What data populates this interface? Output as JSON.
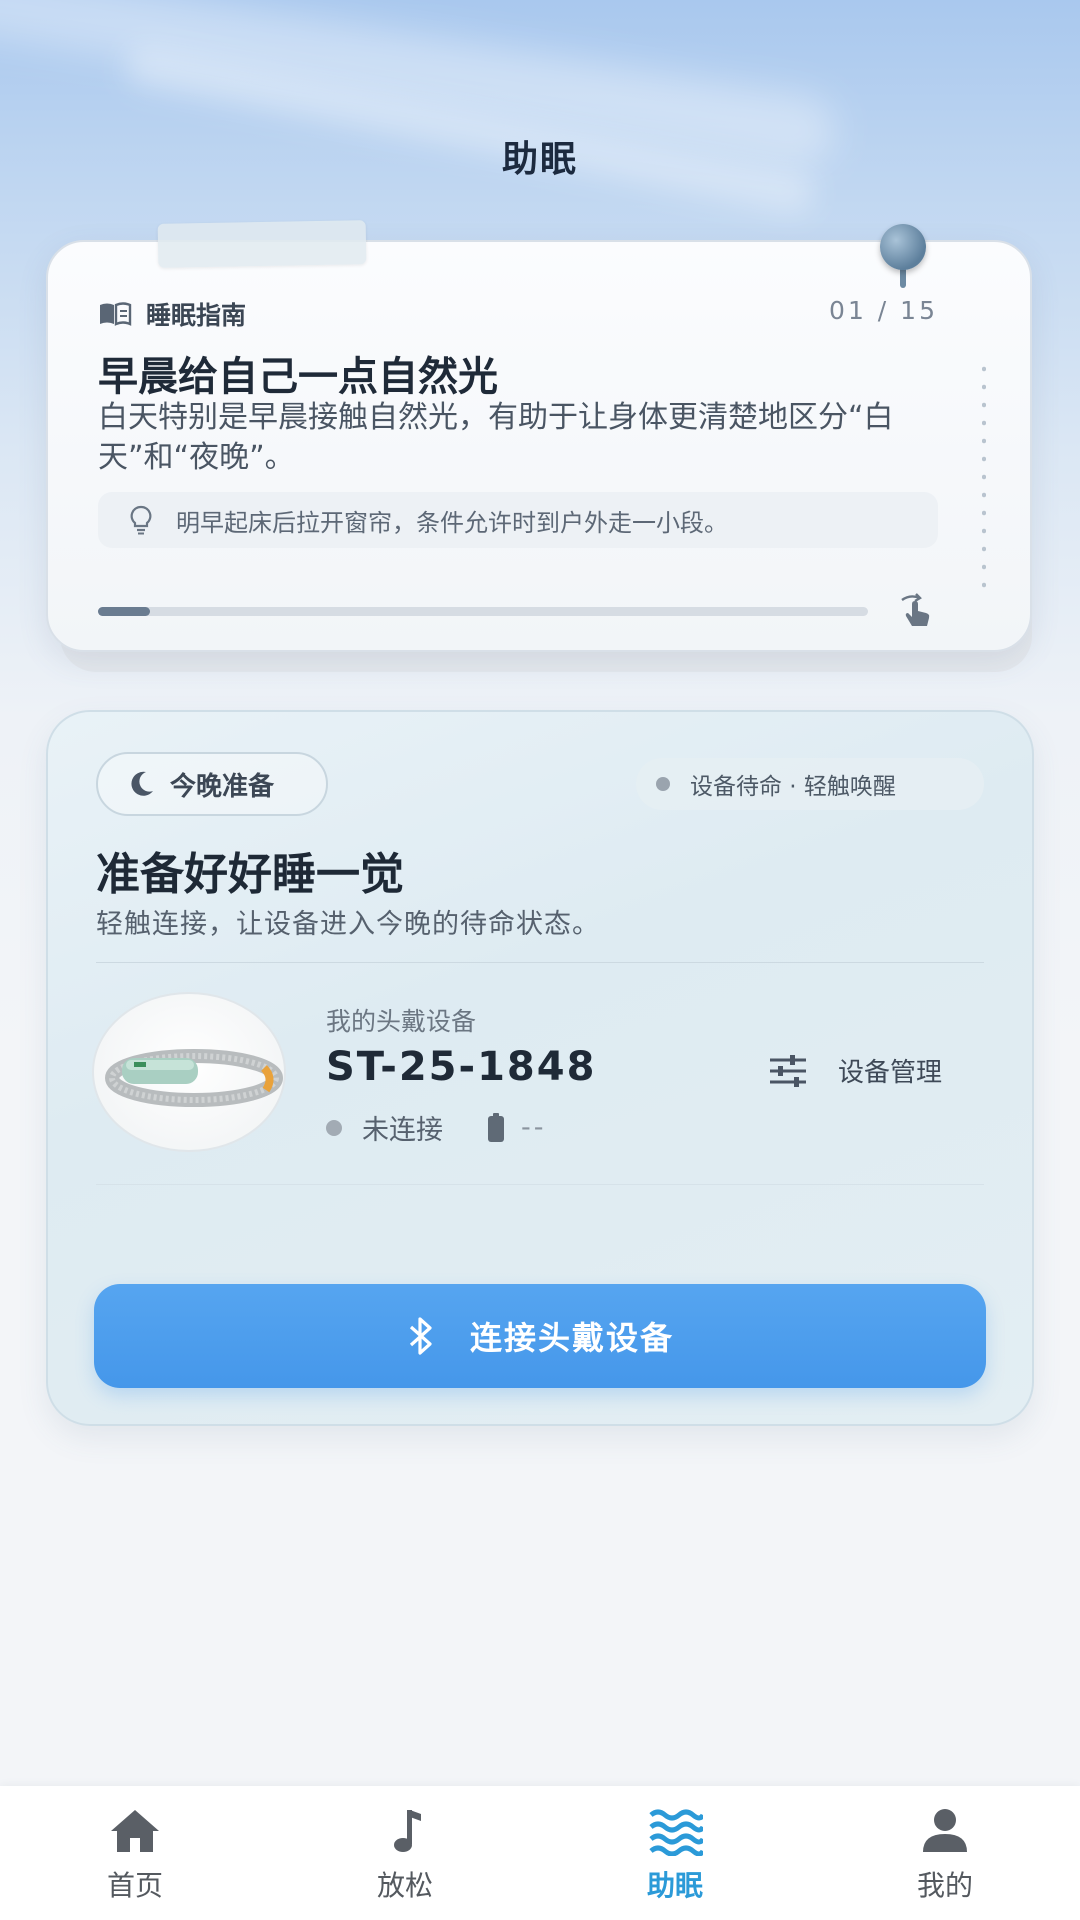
{
  "header": {
    "title": "助眠"
  },
  "guide": {
    "label": "睡眠指南",
    "counter": "01 / 15",
    "progress": 0.067,
    "title": "早晨给自己一点自然光",
    "body": "白天特别是早晨接触自然光，有助于让身体更清楚地区分“白天”和“夜晚”。",
    "tip": "明早起床后拉开窗帘，条件允许时到户外走一小段。"
  },
  "tonight": {
    "pill": "今晚准备",
    "status": "设备待命 · 轻触唤醒",
    "title": "准备好好睡一觉",
    "subtitle": "轻触连接，让设备进入今晚的待命状态。",
    "device": {
      "label": "我的头戴设备",
      "id": "ST-25-1848",
      "connection": "未连接",
      "battery": "--",
      "manage": "设备管理"
    },
    "connect_button": "连接头戴设备"
  },
  "tabs": [
    {
      "label": "首页",
      "icon": "home-icon"
    },
    {
      "label": "放松",
      "icon": "music-note-icon"
    },
    {
      "label": "助眠",
      "icon": "waves-icon",
      "active": true
    },
    {
      "label": "我的",
      "icon": "user-icon"
    }
  ],
  "colors": {
    "accent": "#4597ea",
    "active_tab": "#2b9ad8",
    "title_text": "#1f2a38"
  }
}
